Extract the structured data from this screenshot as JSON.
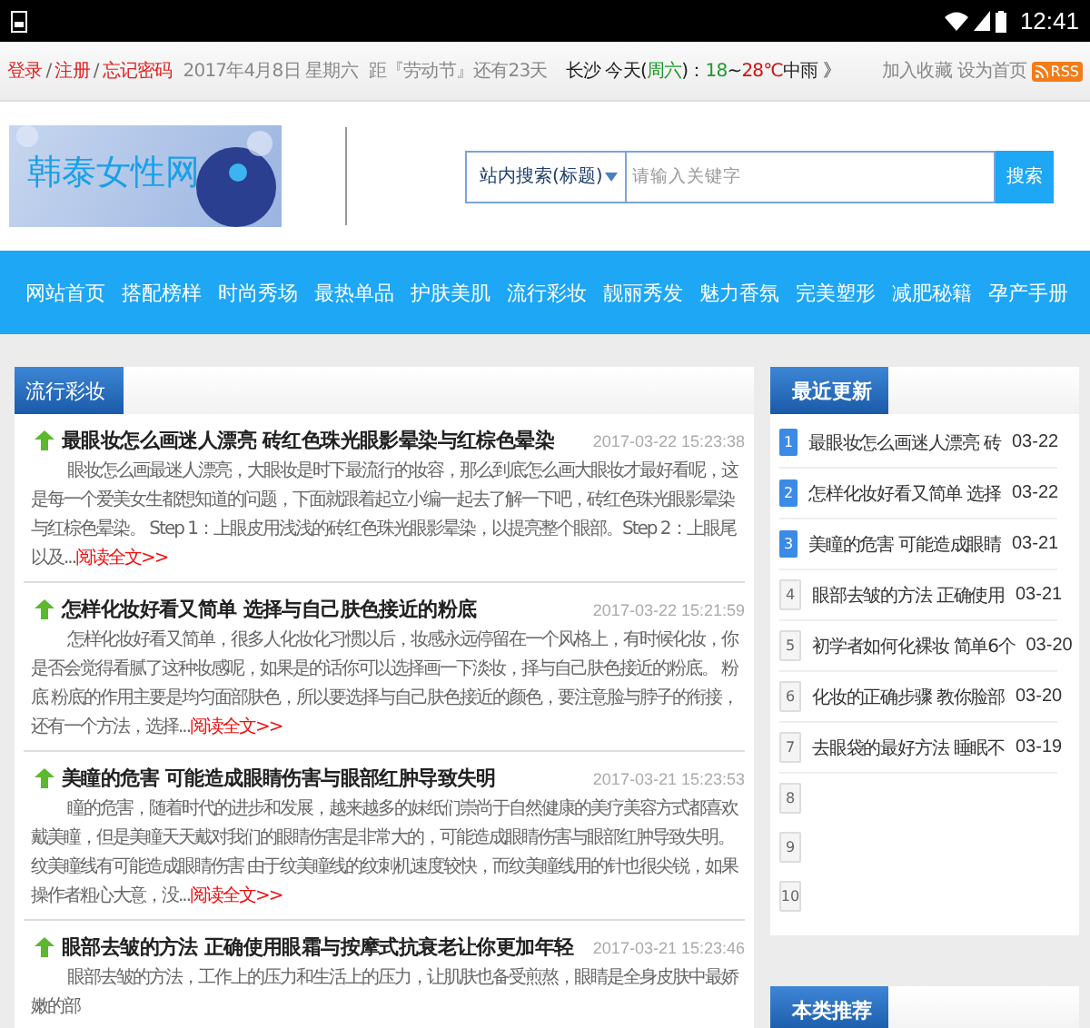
{
  "status_bar": {
    "time": "12:41"
  },
  "top_bar": {
    "account_links": [
      "登录",
      "注册",
      "忘记密码"
    ],
    "separator": "/",
    "date": "2017年4月8日 星期六",
    "countdown": "距『劳动节』还有23天",
    "weather": [
      {
        "text": "长沙  今天(",
        "color": "#222222"
      },
      {
        "text": "周六",
        "color": "#1a9a2a"
      },
      {
        "text": ")：",
        "color": "#222222"
      },
      {
        "text": "18",
        "color": "#1a9a2a"
      },
      {
        "text": "~",
        "color": "#222222"
      },
      {
        "text": "28℃",
        "color": "#d01010"
      },
      {
        "text": "中雨 》",
        "color": "#222222"
      }
    ],
    "links": [
      "加入收藏",
      "设为首页"
    ],
    "rss": "RSS"
  },
  "header": {
    "logo_text": "韩泰女性网",
    "search_scope": "站内搜索(标题)",
    "search": {
      "placeholder": "请输入关键字"
    },
    "search_button": "搜索"
  },
  "nav": [
    "网站首页",
    "搭配榜样",
    "时尚秀场",
    "最热单品",
    "护肤美肌",
    "流行彩妆",
    "靓丽秀发",
    "魅力香氛",
    "完美塑形",
    "减肥秘籍",
    "孕产手册"
  ],
  "main": {
    "title": "流行彩妆",
    "articles": [
      {
        "title": "最眼妆怎么画迷人漂亮 砖红色珠光眼影晕染与红棕色晕染",
        "date": "2017-03-22 15:23:38",
        "summary": "眼妆怎么画最迷人漂亮，大眼妆是时下最流行的妆容，那么到底怎么画大眼妆才最好看呢，这是每一个爱美女生都想知道的问题，下面就跟着起立小编一起去了解一下吧，砖红色珠光眼影晕染与红棕色晕染。 Step 1：上眼皮用浅浅的砖红色珠光眼影晕染，以提亮整个眼部。Step 2：上眼尾以及...",
        "more": "阅读全文>>"
      },
      {
        "title": "怎样化妆好看又简单 选择与自己肤色接近的粉底",
        "date": "2017-03-22 15:21:59",
        "summary": "怎样化妆好看又简单，很多人化妆化习惯以后，妆感永远停留在一个风格上，有时候化妆，你是否会觉得看腻了这种妆感呢，如果是的话你可以选择画一下淡妆，择与自己肤色接近的粉底。 粉底 粉底的作用主要是均匀面部肤色，所以要选择与自己肤色接近的颜色，要注意脸与脖子的衔接，还有一个方法，选择...",
        "more": "阅读全文>>"
      },
      {
        "title": "美瞳的危害 可能造成眼睛伤害与眼部红肿导致失明",
        "date": "2017-03-21 15:23:53",
        "summary": "瞳的危害，随着时代的进步和发展，越来越多的妹纸们崇尚于自然健康的美疗美容方式都喜欢戴美瞳，但是美瞳天天戴对我们的眼睛伤害是非常大的，可能造成眼睛伤害与眼部红肿导致失明。纹美瞳线有可能造成眼睛伤害 由于纹美瞳线的纹刺机速度较快，而纹美瞳线用的针也很尖锐，如果操作者粗心大意，没...",
        "more": "阅读全文>>"
      },
      {
        "title": "眼部去皱的方法 正确使用眼霜与按摩式抗衰老让你更加年轻",
        "date": "2017-03-21 15:23:46",
        "summary": "眼部去皱的方法，工作上的压力和生活上的压力，让肌肤也备受煎熬，眼睛是全身皮肤中最娇嫩的部"
      }
    ]
  },
  "recent": {
    "title": "最近更新",
    "items": [
      {
        "num": "1",
        "highlighted": true,
        "title": "最眼妆怎么画迷人漂亮 砖",
        "date": "03-22"
      },
      {
        "num": "2",
        "highlighted": true,
        "title": "怎样化妆好看又简单 选择",
        "date": "03-22"
      },
      {
        "num": "3",
        "highlighted": true,
        "title": "美瞳的危害 可能造成眼睛",
        "date": "03-21"
      },
      {
        "num": "4",
        "highlighted": false,
        "title": "眼部去皱的方法 正确使用",
        "date": "03-21"
      },
      {
        "num": "5",
        "highlighted": false,
        "title": "初学者如何化裸妆 简单6个",
        "date": "03-20"
      },
      {
        "num": "6",
        "highlighted": false,
        "title": "化妆的正确步骤 教你脸部",
        "date": "03-20"
      },
      {
        "num": "7",
        "highlighted": false,
        "title": "去眼袋的最好方法 睡眠不",
        "date": "03-19"
      },
      {
        "num": "8",
        "highlighted": false
      },
      {
        "num": "9",
        "highlighted": false
      },
      {
        "num": "10",
        "highlighted": false
      }
    ]
  },
  "recommend": {
    "title": "本类推荐"
  }
}
